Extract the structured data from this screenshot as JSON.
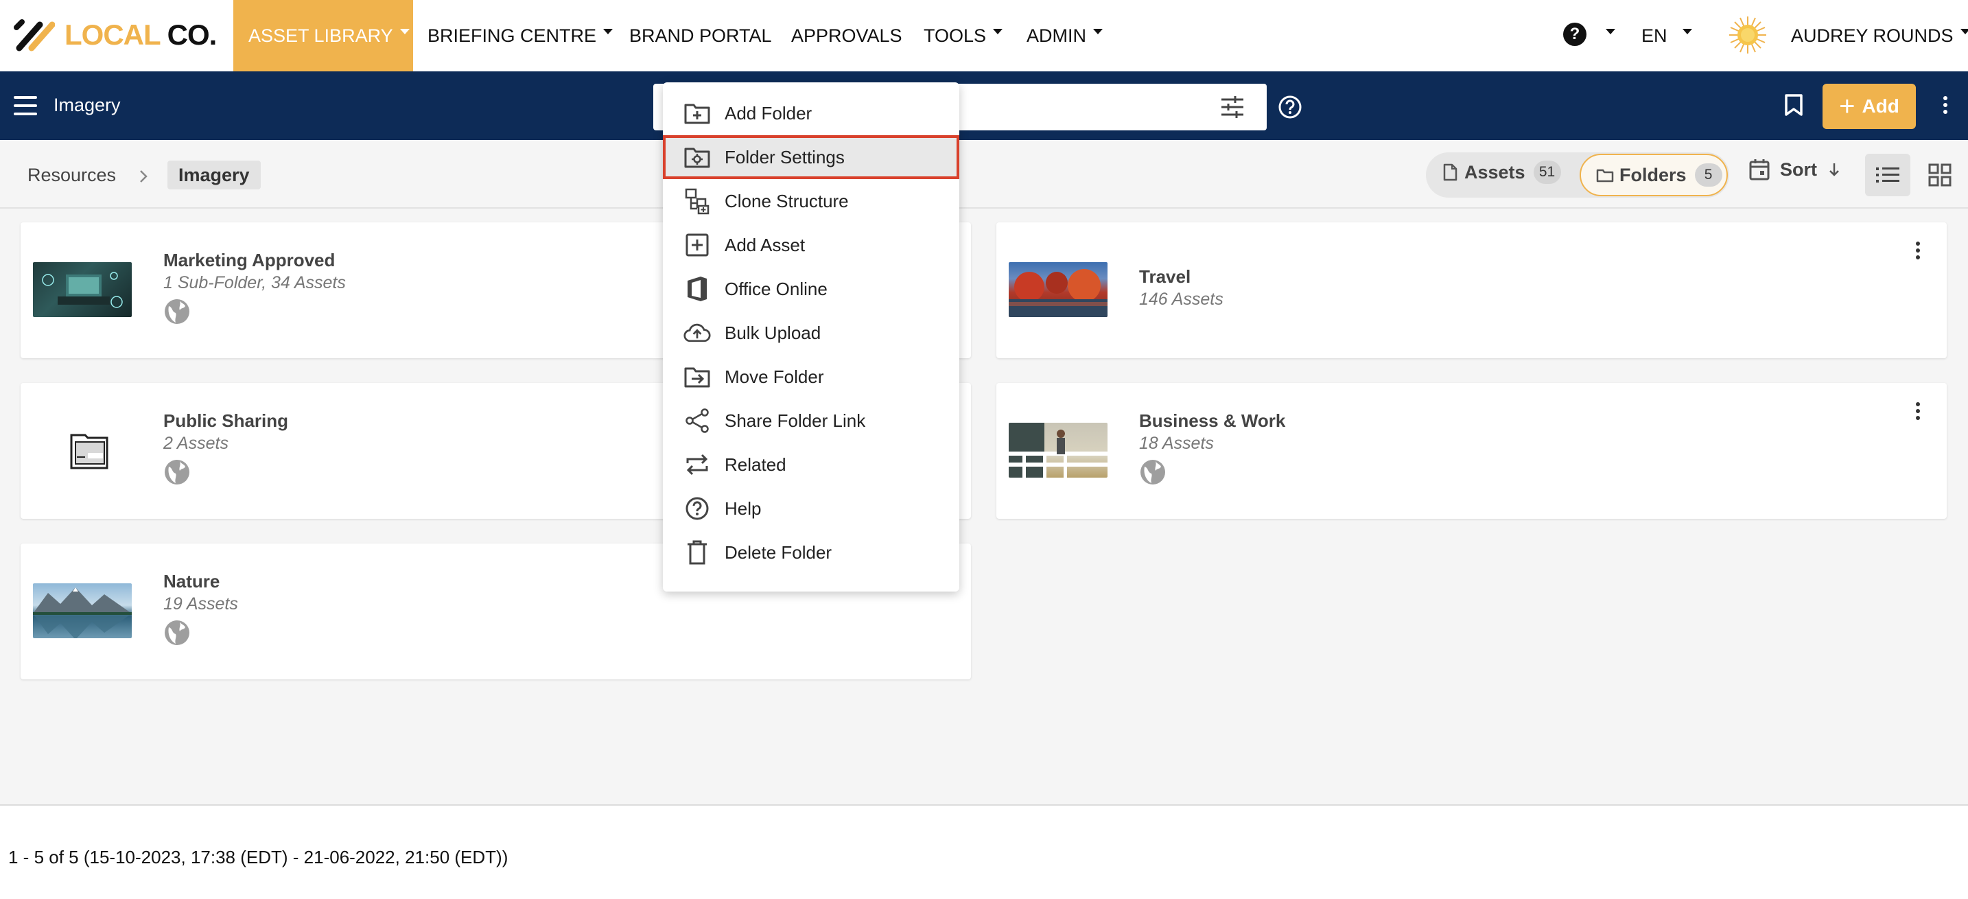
{
  "app": {
    "logo": {
      "local": "LOCAL",
      "co": "CO."
    }
  },
  "nav": {
    "items": [
      {
        "label": "ASSET LIBRARY"
      },
      {
        "label": "BRIEFING CENTRE"
      },
      {
        "label": "BRAND PORTAL"
      },
      {
        "label": "APPROVALS"
      },
      {
        "label": "TOOLS"
      },
      {
        "label": "ADMIN"
      }
    ],
    "help": "?",
    "language": "EN",
    "user": "AUDREY ROUNDS"
  },
  "subbar": {
    "title": "Imagery",
    "add_label": "Add"
  },
  "breadcrumb": {
    "root": "Resources",
    "current": "Imagery"
  },
  "toolbar": {
    "assets_label": "Assets",
    "assets_count": "51",
    "folders_label": "Folders",
    "folders_count": "5",
    "sort_label": "Sort"
  },
  "folders": [
    {
      "title": "Marketing Approved",
      "sub": "1 Sub-Folder, 34 Assets"
    },
    {
      "title": "Travel",
      "sub": "146 Assets"
    },
    {
      "title": "Public Sharing",
      "sub": "2 Assets"
    },
    {
      "title": "Business & Work",
      "sub": "18 Assets"
    },
    {
      "title": "Nature",
      "sub": "19 Assets"
    }
  ],
  "menu": {
    "items": [
      {
        "label": "Add Folder",
        "icon": "folder-plus-icon"
      },
      {
        "label": "Folder Settings",
        "icon": "folder-gear-icon"
      },
      {
        "label": "Clone Structure",
        "icon": "clone-structure-icon"
      },
      {
        "label": "Add Asset",
        "icon": "square-plus-icon"
      },
      {
        "label": "Office Online",
        "icon": "office-icon"
      },
      {
        "label": "Bulk Upload",
        "icon": "cloud-upload-icon"
      },
      {
        "label": "Move Folder",
        "icon": "folder-move-icon"
      },
      {
        "label": "Share Folder Link",
        "icon": "share-icon"
      },
      {
        "label": "Related",
        "icon": "repeat-icon"
      },
      {
        "label": "Help",
        "icon": "help-circle-icon"
      },
      {
        "label": "Delete Folder",
        "icon": "trash-icon"
      }
    ],
    "highlight_color": "#d9412c"
  },
  "footer": {
    "range_text": "1 - 5 of 5 (15-10-2023, 17:38 (EDT) - 21-06-2022, 21:50 (EDT))"
  },
  "colors": {
    "accent": "#f0b34d",
    "navy": "#0d2b57"
  }
}
